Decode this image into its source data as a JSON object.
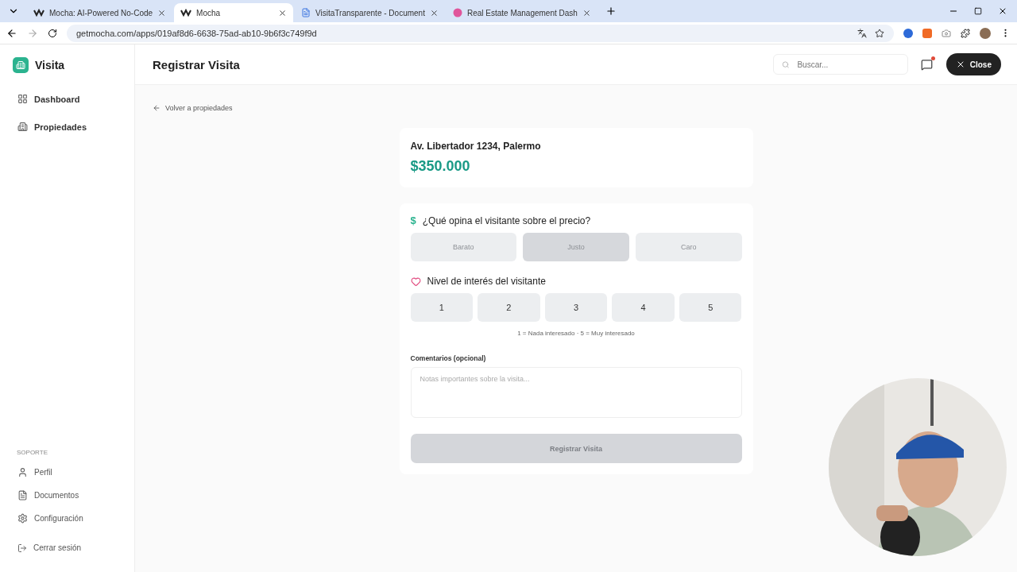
{
  "browser": {
    "tabs": [
      {
        "title": "Mocha: AI-Powered No-Code",
        "selected": false
      },
      {
        "title": "Mocha",
        "selected": true
      },
      {
        "title": "VisitaTransparente - Document",
        "selected": false
      },
      {
        "title": "Real Estate Management Dash",
        "selected": false
      }
    ],
    "url": "getmocha.com/apps/019af8d6-6638-75ad-ab10-9b6f3c749f9d"
  },
  "sidebar": {
    "app_name": "Visita",
    "items": [
      {
        "label": "Dashboard"
      },
      {
        "label": "Propiedades"
      }
    ],
    "support_heading": "SOPORTE",
    "support_items": [
      {
        "label": "Perfil"
      },
      {
        "label": "Documentos"
      },
      {
        "label": "Configuración"
      }
    ],
    "logout": "Cerrar sesión"
  },
  "header": {
    "title": "Registrar Visita",
    "search": {
      "placeholder": "Buscar..."
    },
    "has_notification": true,
    "close_button": "Close"
  },
  "back_link": "Volver a propiedades",
  "property": {
    "address": "Av. Libertador 1234, Palermo",
    "price": "$350.000"
  },
  "price_question": {
    "icon_text": "$",
    "label": "¿Qué opina el visitante sobre el precio?",
    "options": [
      {
        "label": "Barato",
        "selected": false,
        "hovered": false
      },
      {
        "label": "Justo",
        "selected": false,
        "hovered": true
      },
      {
        "label": "Caro",
        "selected": false,
        "hovered": false
      }
    ]
  },
  "interest": {
    "label": "Nivel de interés del visitante",
    "options": [
      {
        "label": "1",
        "selected": false
      },
      {
        "label": "2",
        "selected": false
      },
      {
        "label": "3",
        "selected": false
      },
      {
        "label": "4",
        "selected": false
      },
      {
        "label": "5",
        "selected": false
      }
    ],
    "hint": "1 = Nada interesado · 5 = Muy interesado"
  },
  "comments": {
    "label": "Comentarios (opcional)",
    "placeholder": "Notas importantes sobre la visita..."
  },
  "submit": {
    "label": "Registrar Visita",
    "disabled": true
  }
}
